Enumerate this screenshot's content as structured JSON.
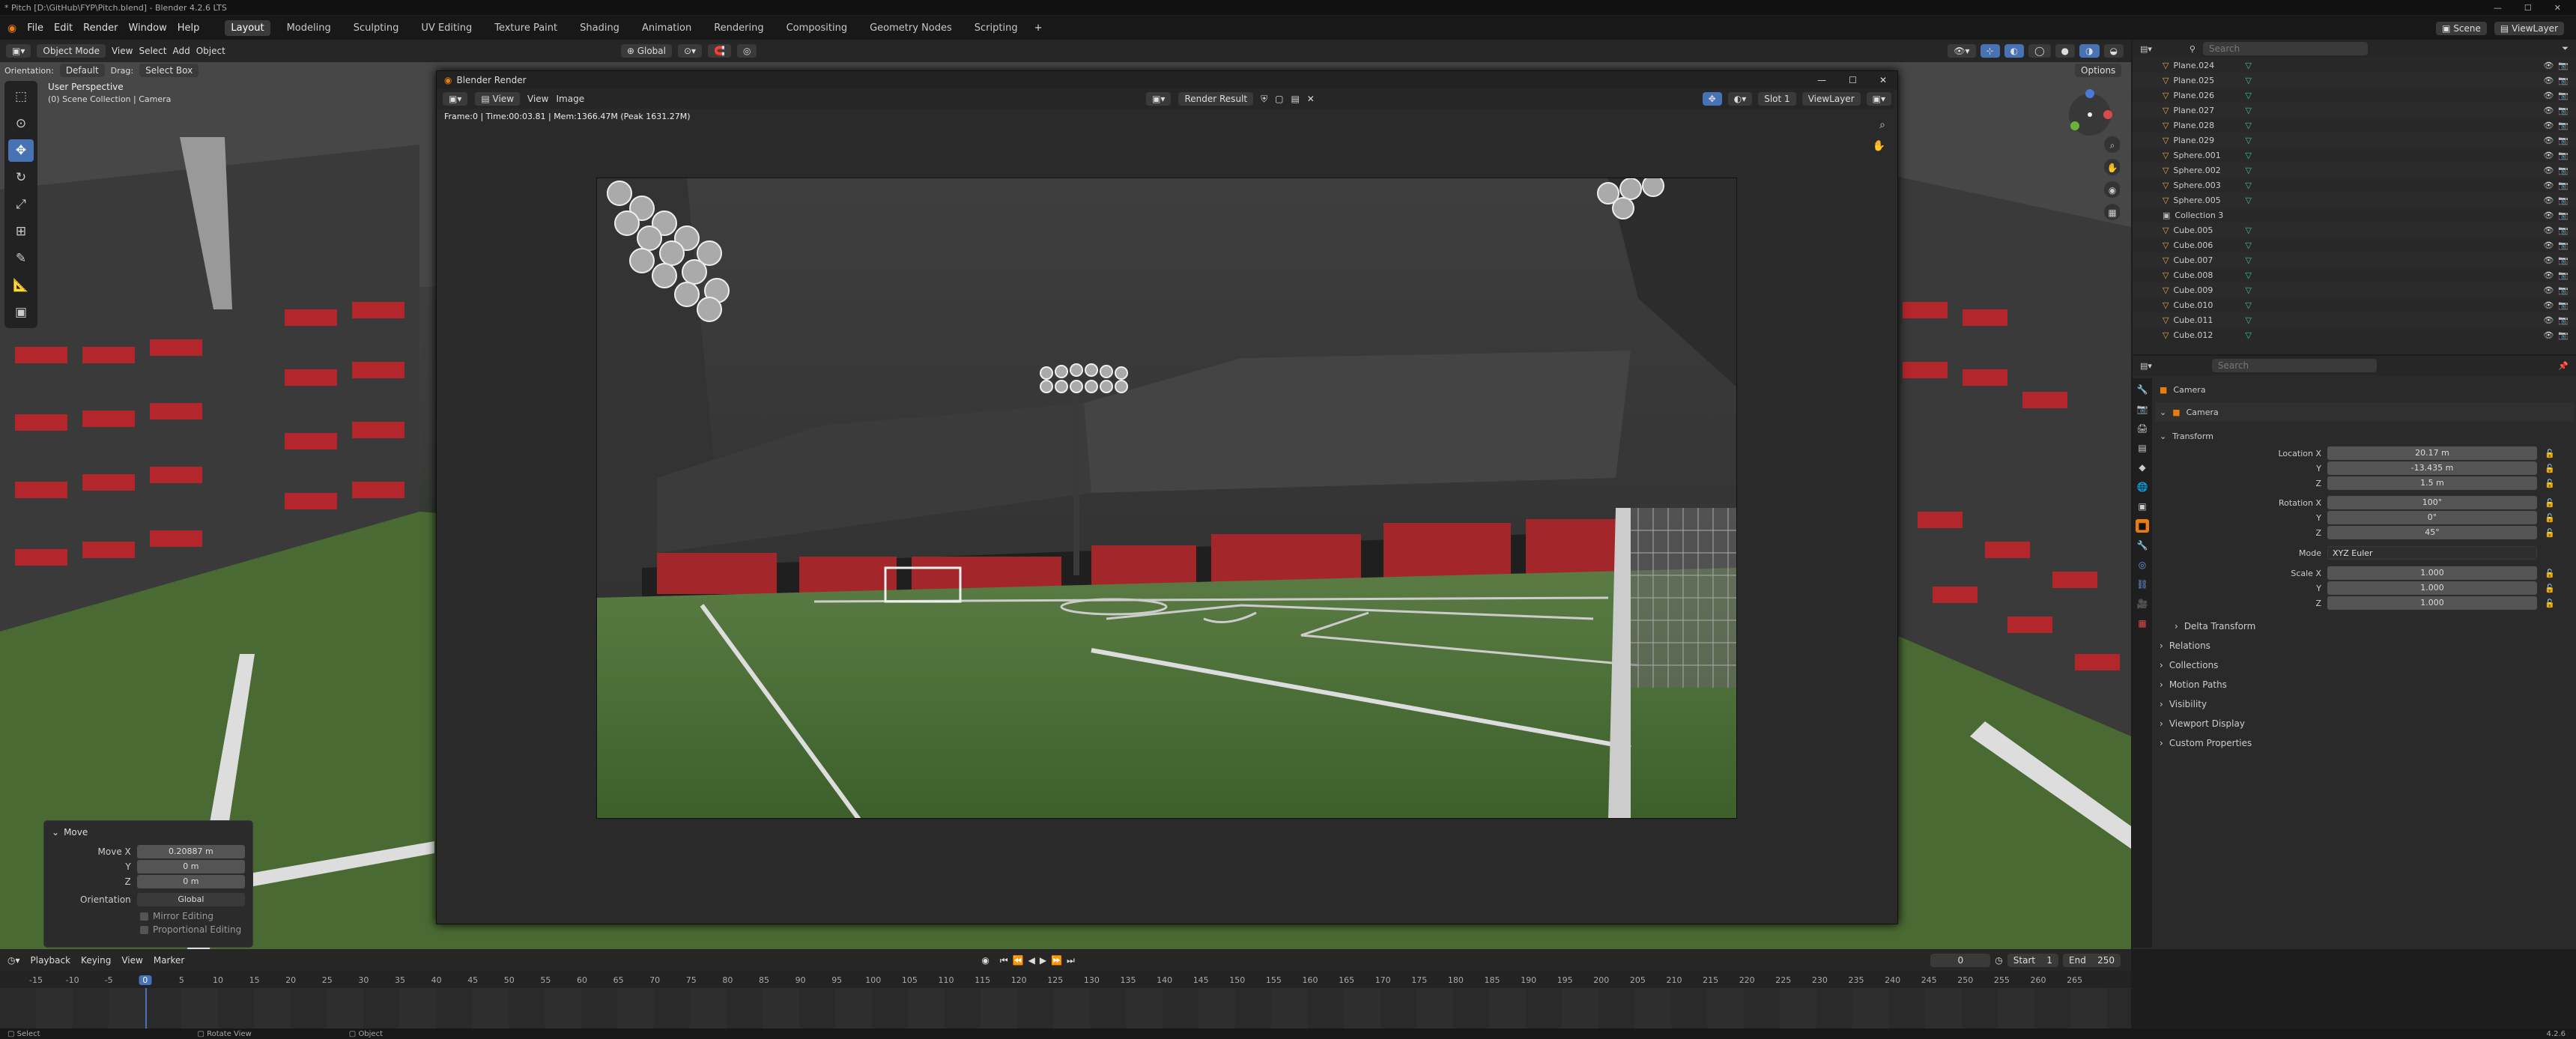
{
  "window": {
    "title": "* Pitch [D:\\GitHub\\FYP\\Pitch.blend] - Blender 4.2.6 LTS"
  },
  "menu": {
    "items": [
      "File",
      "Edit",
      "Render",
      "Window",
      "Help"
    ],
    "workspaces": [
      "Layout",
      "Modeling",
      "Sculpting",
      "UV Editing",
      "Texture Paint",
      "Shading",
      "Animation",
      "Rendering",
      "Compositing",
      "Geometry Nodes",
      "Scripting"
    ],
    "active_workspace": "Layout",
    "add_symbol": "+",
    "scene": "Scene",
    "view_layer": "ViewLayer"
  },
  "header": {
    "mode": "Object Mode",
    "view": "View",
    "select": "Select",
    "add": "Add",
    "object": "Object",
    "transform_orientation": "Global",
    "orientation_label": "Orientation:",
    "orientation_value": "Default",
    "drag_label": "Drag:",
    "drag_value": "Select Box",
    "options": "Options",
    "asset_path": "asset_base_id:7ea70b99-75ac-419e-8526-5d61679b5625"
  },
  "viewport": {
    "perspective": "User Perspective",
    "collection_info": "(0) Scene Collection | Camera"
  },
  "move_panel": {
    "title": "Move",
    "move_x_label": "Move X",
    "move_x": "0.20887 m",
    "y_label": "Y",
    "y": "0 m",
    "z_label": "Z",
    "z": "0 m",
    "orientation_label": "Orientation",
    "orientation": "Global",
    "mirror": "Mirror Editing",
    "proportional": "Proportional Editing"
  },
  "render_window": {
    "title": "Blender Render",
    "view": "View",
    "view2": "View",
    "image": "Image",
    "render_result": "Render Result",
    "slot": "Slot 1",
    "layer": "ViewLayer",
    "stats": "Frame:0 | Time:00:03.81 | Mem:1366.47M (Peak 1631.27M)"
  },
  "outliner": {
    "search_placeholder": "Search",
    "items": [
      {
        "name": "Plane.024",
        "type": "mesh"
      },
      {
        "name": "Plane.025",
        "type": "mesh"
      },
      {
        "name": "Plane.026",
        "type": "mesh"
      },
      {
        "name": "Plane.027",
        "type": "mesh"
      },
      {
        "name": "Plane.028",
        "type": "mesh"
      },
      {
        "name": "Plane.029",
        "type": "mesh"
      },
      {
        "name": "Sphere.001",
        "type": "mesh"
      },
      {
        "name": "Sphere.002",
        "type": "mesh"
      },
      {
        "name": "Sphere.003",
        "type": "mesh"
      },
      {
        "name": "Sphere.005",
        "type": "mesh"
      },
      {
        "name": "Collection 3",
        "type": "collection"
      },
      {
        "name": "Cube.005",
        "type": "mesh"
      },
      {
        "name": "Cube.006",
        "type": "mesh"
      },
      {
        "name": "Cube.007",
        "type": "mesh"
      },
      {
        "name": "Cube.008",
        "type": "mesh"
      },
      {
        "name": "Cube.009",
        "type": "mesh"
      },
      {
        "name": "Cube.010",
        "type": "mesh"
      },
      {
        "name": "Cube.011",
        "type": "mesh"
      },
      {
        "name": "Cube.012",
        "type": "mesh"
      }
    ]
  },
  "properties": {
    "search_placeholder": "Search",
    "object_name": "Camera",
    "data_name": "Camera",
    "transform": "Transform",
    "location_label": "Location X",
    "location": [
      "20.17 m",
      "-13.435 m",
      "1.5 m"
    ],
    "rotation_label": "Rotation X",
    "rotation": [
      "100°",
      "0°",
      "45°"
    ],
    "mode_label": "Mode",
    "mode": "XYZ Euler",
    "scale_label": "Scale X",
    "scale": [
      "1.000",
      "1.000",
      "1.000"
    ],
    "y_label": "Y",
    "z_label": "Z",
    "sections": [
      "Delta Transform",
      "Relations",
      "Collections",
      "Motion Paths",
      "Visibility",
      "Viewport Display",
      "Custom Properties"
    ]
  },
  "timeline": {
    "playback": "Playback",
    "keying": "Keying",
    "view": "View",
    "marker": "Marker",
    "current_frame": "0",
    "start_label": "Start",
    "start": "1",
    "end_label": "End",
    "end": "250",
    "ticks": [
      "-15",
      "-10",
      "-5",
      "0",
      "5",
      "10",
      "15",
      "20",
      "25",
      "30",
      "35",
      "40",
      "45",
      "50",
      "55",
      "60",
      "65",
      "70",
      "75",
      "80",
      "85",
      "90",
      "95",
      "100",
      "105",
      "110",
      "115",
      "120",
      "125",
      "130",
      "135",
      "140",
      "145",
      "150",
      "155",
      "160",
      "165",
      "170",
      "175",
      "180",
      "185",
      "190",
      "195",
      "200",
      "205",
      "210",
      "215",
      "220",
      "225",
      "230",
      "235",
      "240",
      "245",
      "250",
      "255",
      "260",
      "265"
    ]
  },
  "status": {
    "select": "Select",
    "rotate": "Rotate View",
    "object": "Object",
    "version": "4.2.6"
  },
  "colors": {
    "accent": "#4772b3",
    "seat_red": "#b3262b",
    "grass": "#4f7a34"
  }
}
